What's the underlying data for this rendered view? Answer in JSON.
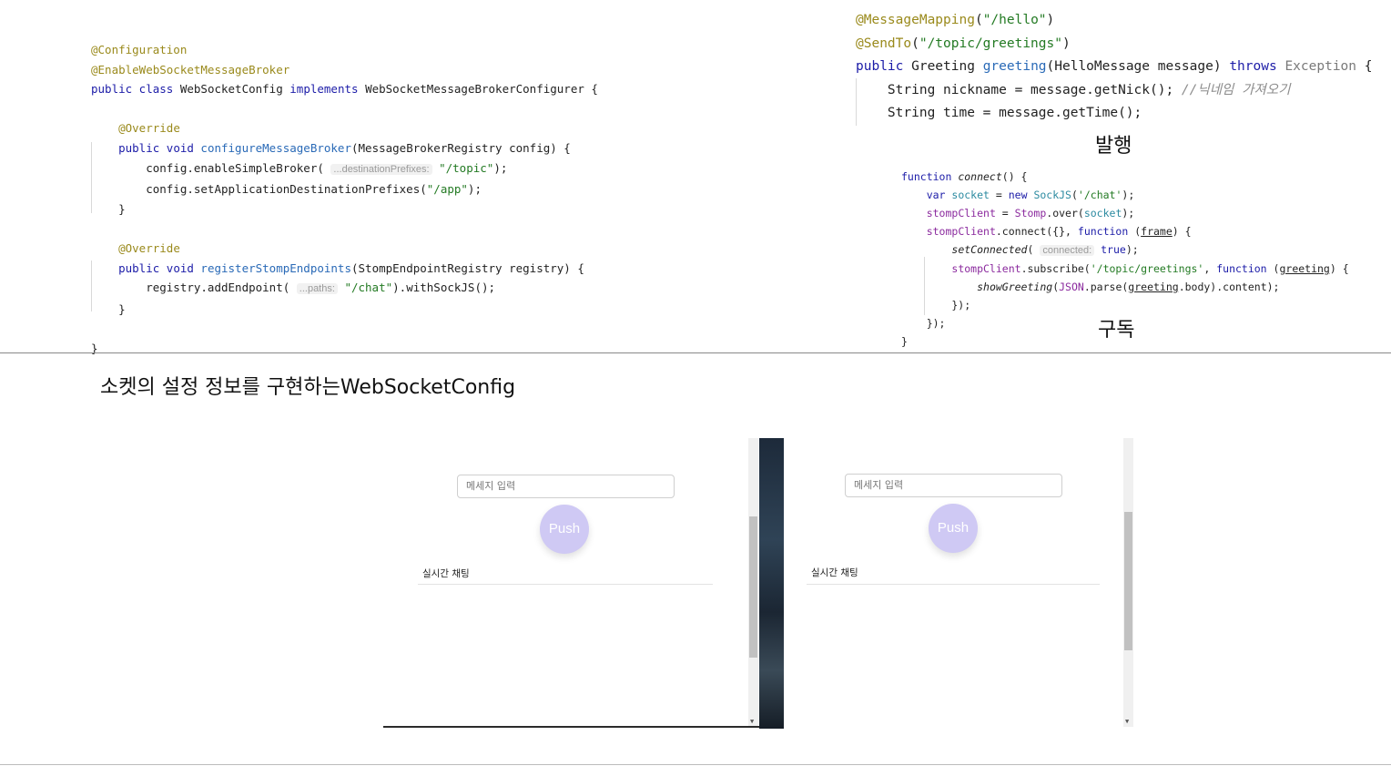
{
  "java_config": [
    [
      [
        "ann",
        "@Configuration"
      ]
    ],
    [
      [
        "ann",
        "@EnableWebSocketMessageBroker"
      ]
    ],
    [
      [
        "kw",
        "public class "
      ],
      [
        "",
        "WebSocketConfig "
      ],
      [
        "kw",
        "implements "
      ],
      [
        "",
        "WebSocketMessageBrokerConfigurer {"
      ]
    ],
    [
      [
        "",
        ""
      ]
    ],
    [
      [
        "",
        "    "
      ],
      [
        "ann",
        "@Override"
      ]
    ],
    [
      [
        "",
        "    "
      ],
      [
        "kw",
        "public void "
      ],
      [
        "fn",
        "configureMessageBroker"
      ],
      [
        "",
        "(MessageBrokerRegistry config) {"
      ]
    ],
    [
      [
        "",
        "        config.enableSimpleBroker( "
      ],
      [
        "hint",
        "...destinationPrefixes:"
      ],
      [
        "",
        " "
      ],
      [
        "str",
        "\"/topic\""
      ],
      [
        "",
        ");"
      ]
    ],
    [
      [
        "",
        "        config.setApplicationDestinationPrefixes("
      ],
      [
        "str",
        "\"/app\""
      ],
      [
        "",
        ");"
      ]
    ],
    [
      [
        "",
        "    }"
      ]
    ],
    [
      [
        "",
        ""
      ]
    ],
    [
      [
        "",
        "    "
      ],
      [
        "ann",
        "@Override"
      ]
    ],
    [
      [
        "",
        "    "
      ],
      [
        "kw",
        "public void "
      ],
      [
        "fn",
        "registerStompEndpoints"
      ],
      [
        "",
        "(StompEndpointRegistry registry) {"
      ]
    ],
    [
      [
        "",
        "        registry.addEndpoint( "
      ],
      [
        "hint",
        "...paths:"
      ],
      [
        "",
        " "
      ],
      [
        "str",
        "\"/chat\""
      ],
      [
        "",
        ").withSockJS();"
      ]
    ],
    [
      [
        "",
        "    }"
      ]
    ],
    [
      [
        "",
        ""
      ]
    ],
    [
      [
        "",
        "}"
      ]
    ]
  ],
  "java_controller": [
    [
      [
        "ann",
        "@MessageMapping"
      ],
      [
        "",
        "("
      ],
      [
        "str",
        "\"/hello\""
      ],
      [
        "",
        ")"
      ]
    ],
    [
      [
        "ann",
        "@SendTo"
      ],
      [
        "",
        "("
      ],
      [
        "str",
        "\"/topic/greetings\""
      ],
      [
        "",
        ")"
      ]
    ],
    [
      [
        "kw",
        "public "
      ],
      [
        "",
        "Greeting "
      ],
      [
        "fn",
        "greeting"
      ],
      [
        "",
        "(HelloMessage message) "
      ],
      [
        "kw",
        "throws "
      ],
      [
        "gray",
        "Exception"
      ],
      [
        "",
        " {"
      ]
    ],
    [
      [
        "",
        "    String nickname = message.getNick(); "
      ],
      [
        "cmt",
        "//닉네임 가져오기"
      ]
    ],
    [
      [
        "",
        "    String time = message.getTime();"
      ]
    ]
  ],
  "js_code": [
    [
      [
        "kw",
        "function "
      ],
      [
        "ital",
        "connect"
      ],
      [
        "",
        "() {"
      ]
    ],
    [
      [
        "",
        "    "
      ],
      [
        "kw",
        "var "
      ],
      [
        "teal",
        "socket"
      ],
      [
        "",
        " = "
      ],
      [
        "kw",
        "new "
      ],
      [
        "teal",
        "SockJS"
      ],
      [
        "",
        "("
      ],
      [
        "str",
        "'/chat'"
      ],
      [
        "",
        ");"
      ]
    ],
    [
      [
        "",
        "    "
      ],
      [
        "purple",
        "stompClient"
      ],
      [
        "",
        " = "
      ],
      [
        "purple",
        "Stomp"
      ],
      [
        "",
        ".over("
      ],
      [
        "teal",
        "socket"
      ],
      [
        "",
        ");"
      ]
    ],
    [
      [
        "",
        "    "
      ],
      [
        "purple",
        "stompClient"
      ],
      [
        "",
        ".connect({}, "
      ],
      [
        "kw",
        "function "
      ],
      [
        "",
        "("
      ],
      [
        "ul",
        "frame"
      ],
      [
        "",
        ") {"
      ]
    ],
    [
      [
        "",
        "        "
      ],
      [
        "ital",
        "setConnected"
      ],
      [
        "",
        "( "
      ],
      [
        "hint",
        "connected:"
      ],
      [
        "",
        " "
      ],
      [
        "kw",
        "true"
      ],
      [
        "",
        ");"
      ]
    ],
    [
      [
        "",
        "        "
      ],
      [
        "purple",
        "stompClient"
      ],
      [
        "",
        ".subscribe("
      ],
      [
        "str",
        "'/topic/greetings'"
      ],
      [
        "",
        ", "
      ],
      [
        "kw",
        "function "
      ],
      [
        "",
        "("
      ],
      [
        "ul",
        "greeting"
      ],
      [
        "",
        ") {"
      ]
    ],
    [
      [
        "",
        "            "
      ],
      [
        "ital",
        "showGreeting"
      ],
      [
        "",
        "("
      ],
      [
        "purple",
        "JSON"
      ],
      [
        "",
        ".parse("
      ],
      [
        "ul",
        "greeting"
      ],
      [
        "",
        ".body).content);"
      ]
    ],
    [
      [
        "",
        "        });"
      ]
    ],
    [
      [
        "",
        "    });"
      ]
    ],
    [
      [
        "",
        "}"
      ]
    ]
  ],
  "labels": {
    "publish": "발행",
    "subscribe": "구독",
    "caption": "소켓의 설정 정보를 구현하는WebSocketConfig"
  },
  "left_window": {
    "input_placeholder": "메세지 입력",
    "push_label": "Push",
    "chat_title": "실시간 채팅"
  },
  "right_window": {
    "input_placeholder": "메세지 입력",
    "push_label": "Push",
    "chat_title": "실시간 채팅"
  },
  "colors": {
    "push_button": "#cfc9f4",
    "keyword": "#1c1ca8",
    "annotation": "#9a8a1c",
    "string": "#237a23"
  }
}
